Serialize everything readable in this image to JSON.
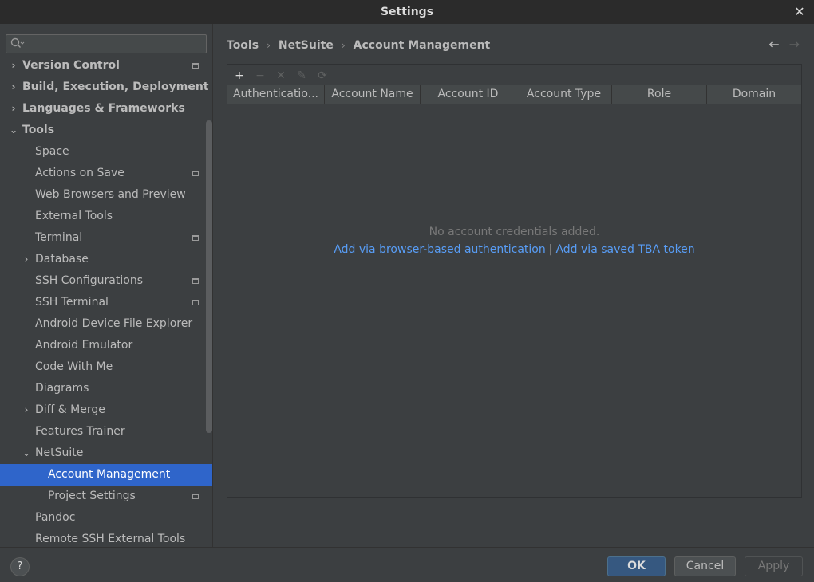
{
  "window": {
    "title": "Settings",
    "close_glyph": "✕"
  },
  "search": {
    "placeholder": "",
    "value": ""
  },
  "sidebar": {
    "items": [
      {
        "label": "Version Control",
        "level": 0,
        "chevron": "›",
        "bold": true,
        "project": true
      },
      {
        "label": "Build, Execution, Deployment",
        "level": 0,
        "chevron": "›",
        "bold": true,
        "project": false
      },
      {
        "label": "Languages & Frameworks",
        "level": 0,
        "chevron": "›",
        "bold": true,
        "project": false
      },
      {
        "label": "Tools",
        "level": 0,
        "chevron": "⌄",
        "bold": true,
        "project": false
      },
      {
        "label": "Space",
        "level": 1,
        "chevron": "",
        "bold": false,
        "project": false
      },
      {
        "label": "Actions on Save",
        "level": 1,
        "chevron": "",
        "bold": false,
        "project": true
      },
      {
        "label": "Web Browsers and Preview",
        "level": 1,
        "chevron": "",
        "bold": false,
        "project": false
      },
      {
        "label": "External Tools",
        "level": 1,
        "chevron": "",
        "bold": false,
        "project": false
      },
      {
        "label": "Terminal",
        "level": 1,
        "chevron": "",
        "bold": false,
        "project": true
      },
      {
        "label": "Database",
        "level": 1,
        "chevron": "›",
        "bold": false,
        "project": false
      },
      {
        "label": "SSH Configurations",
        "level": 1,
        "chevron": "",
        "bold": false,
        "project": true
      },
      {
        "label": "SSH Terminal",
        "level": 1,
        "chevron": "",
        "bold": false,
        "project": true
      },
      {
        "label": "Android Device File Explorer",
        "level": 1,
        "chevron": "",
        "bold": false,
        "project": false
      },
      {
        "label": "Android Emulator",
        "level": 1,
        "chevron": "",
        "bold": false,
        "project": false
      },
      {
        "label": "Code With Me",
        "level": 1,
        "chevron": "",
        "bold": false,
        "project": false
      },
      {
        "label": "Diagrams",
        "level": 1,
        "chevron": "",
        "bold": false,
        "project": false
      },
      {
        "label": "Diff & Merge",
        "level": 1,
        "chevron": "›",
        "bold": false,
        "project": false
      },
      {
        "label": "Features Trainer",
        "level": 1,
        "chevron": "",
        "bold": false,
        "project": false
      },
      {
        "label": "NetSuite",
        "level": 1,
        "chevron": "⌄",
        "bold": false,
        "project": false
      },
      {
        "label": "Account Management",
        "level": 2,
        "chevron": "",
        "bold": false,
        "project": false,
        "selected": true
      },
      {
        "label": "Project Settings",
        "level": 2,
        "chevron": "",
        "bold": false,
        "project": true
      },
      {
        "label": "Pandoc",
        "level": 1,
        "chevron": "",
        "bold": false,
        "project": false
      },
      {
        "label": "Remote SSH External Tools",
        "level": 1,
        "chevron": "",
        "bold": false,
        "project": false
      }
    ]
  },
  "breadcrumb": {
    "items": [
      "Tools",
      "NetSuite",
      "Account Management"
    ],
    "separator": "›"
  },
  "nav": {
    "back": "←",
    "forward": "→"
  },
  "toolbar": {
    "add": "+",
    "remove": "−",
    "clear": "✕",
    "edit": "✎",
    "refresh": "⟳"
  },
  "table": {
    "columns": [
      "Authenticatio...",
      "Account Name",
      "Account ID",
      "Account Type",
      "Role",
      "Domain"
    ],
    "empty_text": "No account credentials added.",
    "link_browser": "Add via browser-based authentication",
    "link_separator": "|",
    "link_tba": "Add via saved TBA token"
  },
  "footer": {
    "help": "?",
    "ok": "OK",
    "cancel": "Cancel",
    "apply": "Apply"
  },
  "colors": {
    "accent": "#2f65ca",
    "link": "#589df6",
    "ok_button": "#365880"
  }
}
